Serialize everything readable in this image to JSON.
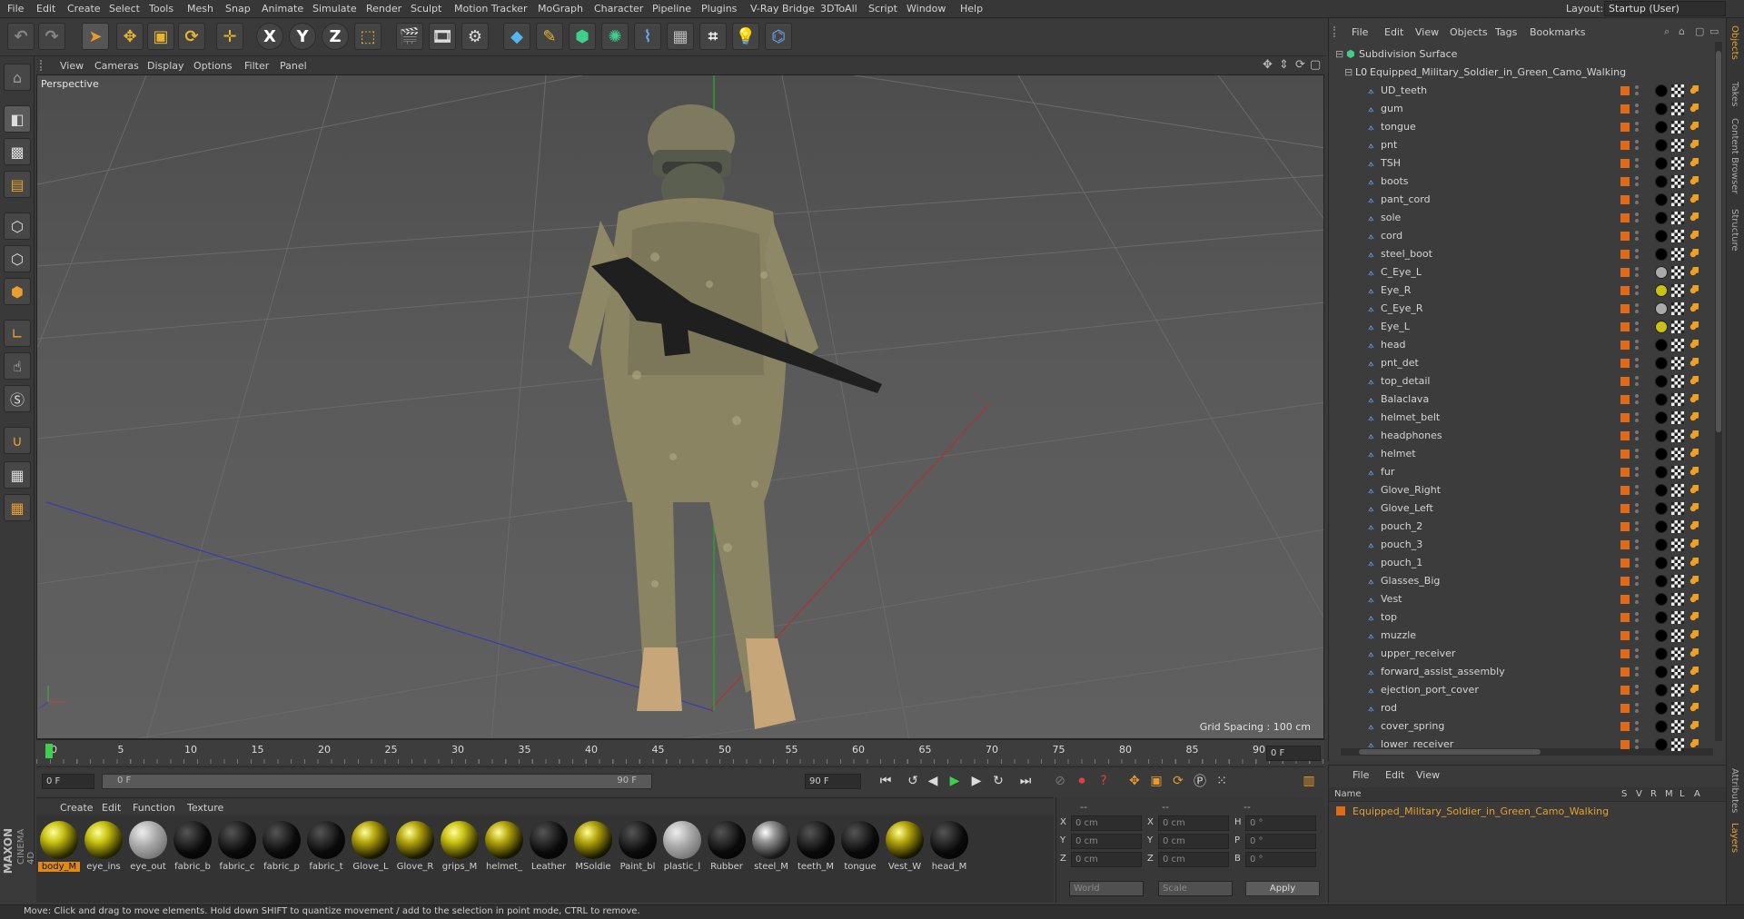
{
  "menubar": {
    "items": [
      "File",
      "Edit",
      "Create",
      "Select",
      "Tools",
      "Mesh",
      "Snap",
      "Animate",
      "Simulate",
      "Render",
      "Sculpt",
      "Motion Tracker",
      "MoGraph",
      "Character",
      "Pipeline",
      "Plugins",
      "V-Ray Bridge",
      "3DToAll",
      "Script",
      "Window",
      "Help"
    ]
  },
  "layout": {
    "label": "Layout:",
    "value": "Startup (User)"
  },
  "toolbar": {
    "axis_x": "X",
    "axis_y": "Y",
    "axis_z": "Z"
  },
  "viewport": {
    "menu": [
      "View",
      "Cameras",
      "Display",
      "Options",
      "Filter",
      "Panel"
    ],
    "label": "Perspective",
    "grid_spacing": "Grid Spacing : 100 cm"
  },
  "timeline": {
    "ticks": [
      "0",
      "5",
      "10",
      "15",
      "20",
      "25",
      "30",
      "35",
      "40",
      "45",
      "50",
      "55",
      "60",
      "65",
      "70",
      "75",
      "80",
      "85",
      "90"
    ],
    "current_frame": "0 F"
  },
  "playbar": {
    "start": "0 F",
    "range_start": "0 F",
    "range_end": "90 F",
    "end": "90 F"
  },
  "materials": {
    "menu": [
      "Create",
      "Edit",
      "Function",
      "Texture"
    ],
    "items": [
      {
        "label": "body_M",
        "type": "y",
        "selected": true
      },
      {
        "label": "eye_ins",
        "type": "y"
      },
      {
        "label": "eye_out",
        "type": "g"
      },
      {
        "label": "fabric_b",
        "type": "b"
      },
      {
        "label": "fabric_c",
        "type": "b"
      },
      {
        "label": "fabric_p",
        "type": "b"
      },
      {
        "label": "fabric_t",
        "type": "b"
      },
      {
        "label": "Glove_L",
        "type": "o"
      },
      {
        "label": "Glove_R",
        "type": "o"
      },
      {
        "label": "grips_M",
        "type": "y"
      },
      {
        "label": "helmet_",
        "type": "o"
      },
      {
        "label": "Leather",
        "type": "b"
      },
      {
        "label": "MSoldie",
        "type": "o"
      },
      {
        "label": "Paint_bl",
        "type": "b"
      },
      {
        "label": "plastic_l",
        "type": "g"
      },
      {
        "label": "Rubber",
        "type": "b"
      },
      {
        "label": "steel_M",
        "type": "s"
      },
      {
        "label": "teeth_M",
        "type": "b"
      },
      {
        "label": "tongue",
        "type": "b"
      },
      {
        "label": "Vest_W",
        "type": "o"
      },
      {
        "label": "head_M",
        "type": "b"
      }
    ]
  },
  "coords": {
    "rows": [
      {
        "a": "X",
        "av": "0 cm",
        "b": "X",
        "bv": "0 cm",
        "c": "H",
        "cv": "0 °"
      },
      {
        "a": "Y",
        "av": "0 cm",
        "b": "Y",
        "bv": "0 cm",
        "c": "P",
        "cv": "0 °"
      },
      {
        "a": "Z",
        "av": "0 cm",
        "b": "Z",
        "bv": "0 cm",
        "c": "B",
        "cv": "0 °"
      }
    ],
    "mode": "World",
    "scale": "Scale",
    "apply": "Apply",
    "dash1": "--",
    "dash2": "--",
    "dash3": "--"
  },
  "objects": {
    "menu": [
      "File",
      "Edit",
      "View",
      "Objects",
      "Tags",
      "Bookmarks"
    ],
    "root": "Subdivision Surface",
    "parent": "Equipped_Military_Soldier_in_Green_Camo_Walking",
    "children": [
      "UD_teeth",
      "gum",
      "tongue",
      "pnt",
      "TSH",
      "boots",
      "pant_cord",
      "sole",
      "cord",
      "steel_boot",
      "C_Eye_L",
      "Eye_R",
      "C_Eye_R",
      "Eye_L",
      "head",
      "pnt_det",
      "top_detail",
      "Balaclava",
      "helmet_belt",
      "headphones",
      "helmet",
      "fur",
      "Glove_Right",
      "Glove_Left",
      "pouch_2",
      "pouch_3",
      "pouch_1",
      "Glasses_Big",
      "Vest",
      "top",
      "muzzle",
      "upper_receiver",
      "forward_assist_assembly",
      "ejection_port_cover",
      "rod",
      "cover_spring",
      "lower_receiver"
    ]
  },
  "layers": {
    "menu": [
      "File",
      "Edit",
      "View"
    ],
    "header": "Name",
    "cols": [
      "S",
      "V",
      "R",
      "M",
      "L",
      "A"
    ],
    "row": "Equipped_Military_Soldier_in_Green_Camo_Walking"
  },
  "side_tabs": [
    "Objects",
    "Takes",
    "Content Browser",
    "Structure"
  ],
  "side_tabs_bottom": [
    "Attributes",
    "Layers"
  ],
  "status": "Move: Click and drag to move elements. Hold down SHIFT to quantize movement / add to the selection in point mode, CTRL to remove.",
  "brand": {
    "line1": "MAXON",
    "line2": "CINEMA 4D"
  }
}
